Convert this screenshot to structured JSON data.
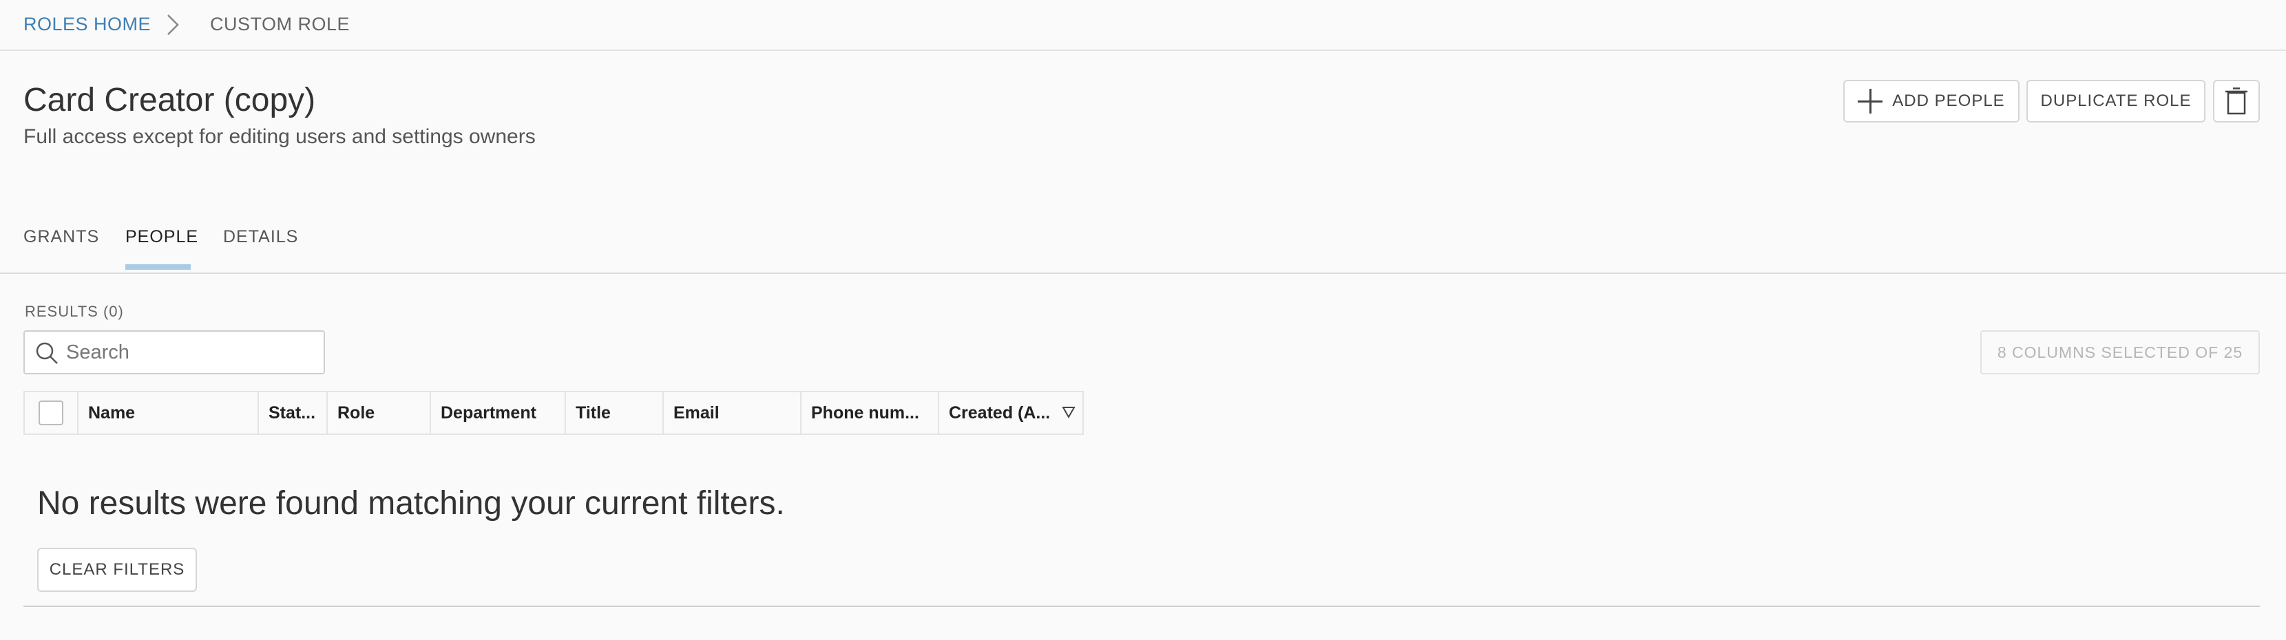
{
  "breadcrumb": {
    "home": "ROLES HOME",
    "current": "CUSTOM ROLE",
    "separator_icon": "chevron-right-icon"
  },
  "header": {
    "title": "Card Creator (copy)",
    "subtitle": "Full access except for editing users and settings owners",
    "add_people": "ADD PEOPLE",
    "duplicate_role": "DUPLICATE ROLE",
    "delete_icon": "trash-icon"
  },
  "tabs": [
    {
      "label": "GRANTS",
      "active": false
    },
    {
      "label": "PEOPLE",
      "active": true
    },
    {
      "label": "DETAILS",
      "active": false
    }
  ],
  "results": {
    "label": "RESULTS (0)",
    "search_placeholder": "Search",
    "columns_selected": "8 COLUMNS SELECTED OF 25"
  },
  "table": {
    "columns": [
      "Name",
      "Stat...",
      "Role",
      "Department",
      "Title",
      "Email",
      "Phone num...",
      "Created (A..."
    ],
    "sorted_column": "Created (A...",
    "sort_icon": "sort-descending-icon",
    "rows": []
  },
  "empty_state": {
    "message": "No results were found matching your current filters.",
    "clear_filters": "CLEAR FILTERS"
  },
  "colors": {
    "link": "#3d7fb5",
    "active_tab_underline": "#a9cbe6",
    "background": "#fafafa"
  }
}
